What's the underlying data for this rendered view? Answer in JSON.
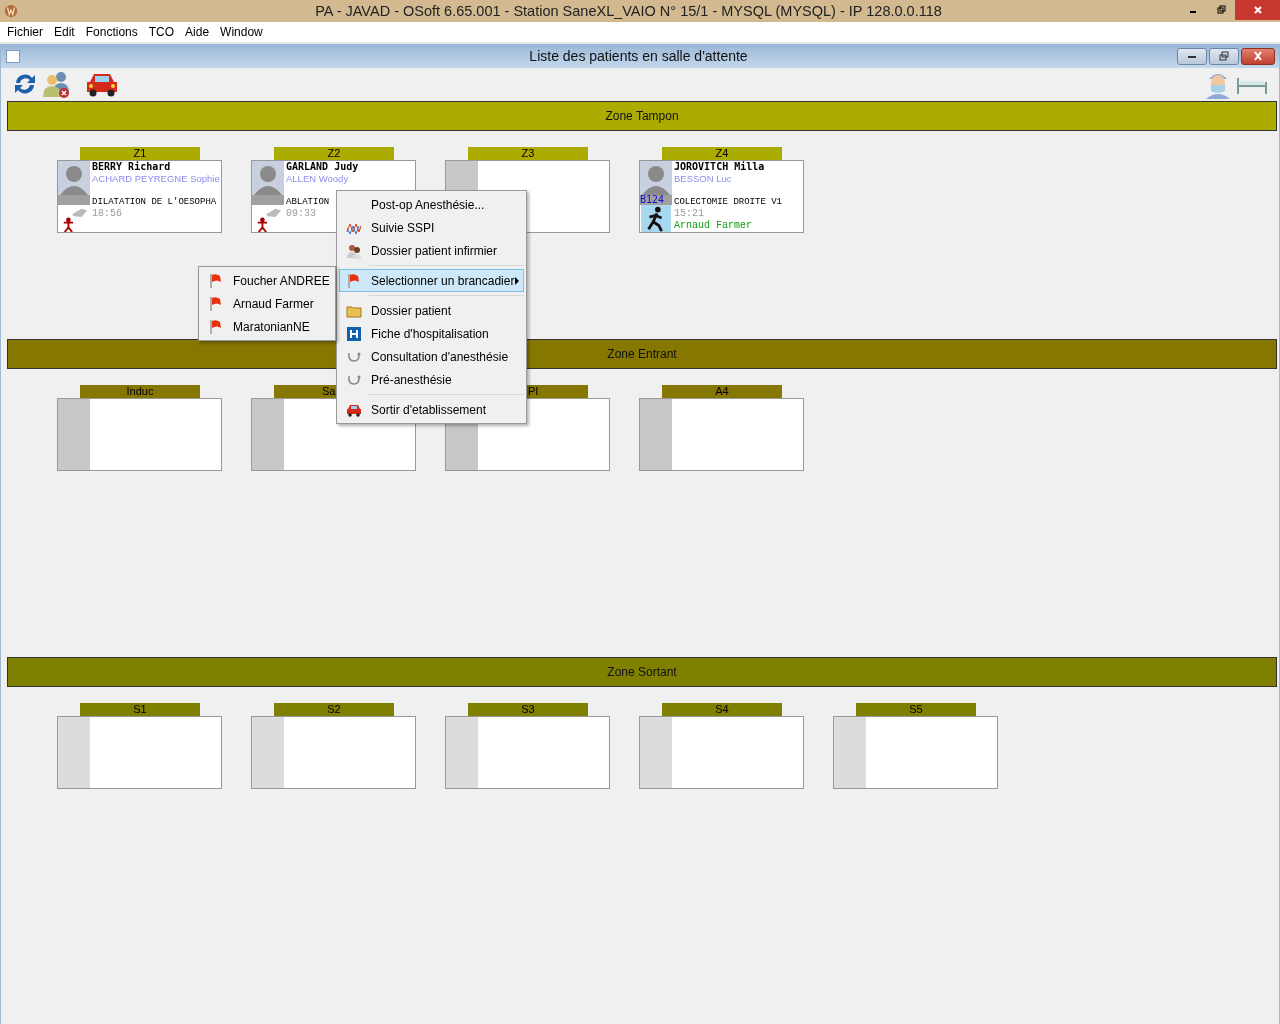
{
  "window": {
    "title": "PA - JAVAD - OSoft 6.65.001 - Station SaneXL_VAIO N° 15/1 - MYSQL (MYSQL) - IP 128.0.0.118"
  },
  "menu": [
    "Fichier",
    "Edit",
    "Fonctions",
    "TCO",
    "Aide",
    "Window"
  ],
  "inner_window": {
    "title": "Liste des patients en salle d'attente"
  },
  "zones": [
    {
      "name": "Zone Tampon",
      "kind": "tampon",
      "slots": [
        {
          "label": "Z1",
          "patient": {
            "name": "BERRY Richard",
            "surgeon": "ACHARD PEYREGNE Sophie",
            "procedure": "DILATATION DE L'OESOPHA",
            "time": "18:56",
            "en_route": false
          }
        },
        {
          "label": "Z2",
          "patient": {
            "name": "GARLAND Judy",
            "surgeon": "ALLEN Woody",
            "procedure": "ABLATION",
            "time": "09:33",
            "en_route": false
          }
        },
        {
          "label": "Z3"
        },
        {
          "label": "Z4",
          "patient": {
            "name": "JOROVITCH Milla",
            "surgeon": "BESSON Luc",
            "room": "B124",
            "procedure": "COLECTOMIE DROITE V1",
            "time": "15:21",
            "brancardier": "Arnaud Farmer",
            "en_route": true
          }
        }
      ]
    },
    {
      "name": "Zone Entrant",
      "kind": "entrant",
      "slots": [
        {
          "label": "Induc"
        },
        {
          "label": "Sa",
          "clipped_right": true
        },
        {
          "label": "PI",
          "clipped_left": true
        },
        {
          "label": "A4"
        }
      ]
    },
    {
      "name": "Zone Sortant",
      "kind": "sortant",
      "slots": [
        {
          "label": "S1"
        },
        {
          "label": "S2"
        },
        {
          "label": "S3"
        },
        {
          "label": "S4"
        },
        {
          "label": "S5"
        }
      ]
    }
  ],
  "context_menu": {
    "groups": [
      [
        {
          "label": "Post-op Anesthésie...",
          "kind": "plain",
          "selected": false
        },
        {
          "label": "Suivie SSPI",
          "kind": "chart",
          "selected": false
        },
        {
          "label": "Dossier patient infirmier",
          "kind": "people",
          "selected": false
        }
      ],
      [
        {
          "label": "Selectionner un brancadier",
          "kind": "flag",
          "selected": true,
          "has_submenu": true
        }
      ],
      [
        {
          "label": "Dossier patient",
          "kind": "folder",
          "selected": false
        },
        {
          "label": "Fiche d'hospitalisation",
          "kind": "hospital",
          "selected": false
        },
        {
          "label": "Consultation d'anesthésie",
          "kind": "stethoscope",
          "selected": false
        },
        {
          "label": "Pré-anesthésie",
          "kind": "stethoscope",
          "selected": false
        }
      ],
      [
        {
          "label": "Sortir d'etablissement",
          "kind": "car",
          "selected": false
        }
      ]
    ]
  },
  "submenu": [
    {
      "label": "Foucher ANDREE",
      "selected": false
    },
    {
      "label": "Arnaud Farmer",
      "selected": false
    },
    {
      "label": "MaratonianNE",
      "selected": false
    }
  ]
}
